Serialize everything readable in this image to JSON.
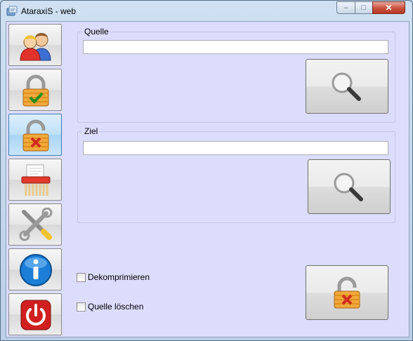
{
  "window": {
    "title": "AtaraxiS - web"
  },
  "titlebar_buttons": {
    "minimize": "–",
    "maximize": "□",
    "close": "✕"
  },
  "sidebar": {
    "items": [
      {
        "icon": "users-icon",
        "active": false
      },
      {
        "icon": "lock-check-icon",
        "active": false
      },
      {
        "icon": "unlock-x-icon",
        "active": true
      },
      {
        "icon": "shredder-icon",
        "active": false
      },
      {
        "icon": "tools-icon",
        "active": false
      },
      {
        "icon": "info-icon",
        "active": false
      },
      {
        "icon": "power-icon",
        "active": false
      }
    ]
  },
  "source": {
    "label": "Quelle",
    "value": ""
  },
  "target": {
    "label": "Ziel",
    "value": ""
  },
  "options": {
    "decompress_label": "Dekomprimieren",
    "delete_source_label": "Quelle löschen",
    "decompress_checked": false,
    "delete_source_checked": false
  },
  "colors": {
    "client_bg": "#dcdcfc",
    "accent": "#3c7fb1"
  }
}
